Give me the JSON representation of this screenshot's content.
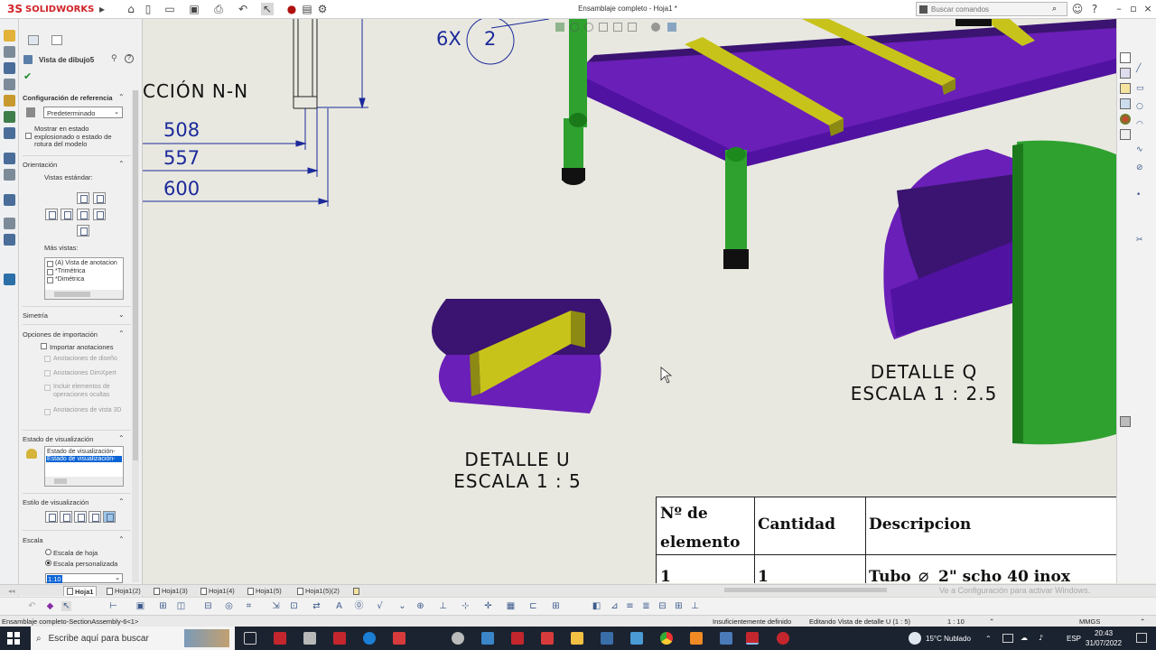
{
  "titlebar": {
    "brand_ds": "3S",
    "brand_name": "SOLIDWORKS",
    "document_title": "Ensamblaje completo - Hoja1 *",
    "search_placeholder": "Buscar comandos"
  },
  "property_manager": {
    "title": "Vista de dibujo5",
    "sections": {
      "reference_config": {
        "header": "Configuración de referencia",
        "selected": "Predeterminado",
        "explode_label": "Mostrar en estado explosionado o estado de rotura del modelo"
      },
      "orientation": {
        "header": "Orientación",
        "standard_views_label": "Vistas estándar:",
        "more_views_label": "Más vistas:",
        "more_views": [
          "(A) Vista de anotacion",
          "*Trimétrica",
          "*Dimétrica"
        ]
      },
      "symmetry": {
        "header": "Simetría"
      },
      "import_options": {
        "header": "Opciones de importación",
        "import_annotations": "Importar anotaciones",
        "design_annotations": "Anotaciones de diseño",
        "dimxpert_annotations": "Anotaciones DimXpert",
        "hidden_ops": "Incluir elementos de operaciones ocultas",
        "view3d_annotations": "Anotaciones de vista 3D"
      },
      "display_state": {
        "header": "Estado de visualización",
        "items": [
          "Estado de visualización-",
          "Estado de visualización-"
        ]
      },
      "display_style": {
        "header": "Estilo de visualización"
      },
      "scale": {
        "header": "Escala",
        "sheet_scale": "Escala de hoja",
        "custom_scale": "Escala personalizada",
        "custom_value": "1:10"
      }
    }
  },
  "drawing": {
    "section_title": "CCIÓN N-N",
    "balloon_qty": "6X",
    "balloon_number": "2",
    "dimensions": [
      "508",
      "557",
      "600"
    ],
    "detail_u": {
      "line1": "DETALLE U",
      "line2": "ESCALA 1 : 5"
    },
    "detail_q": {
      "line1": "DETALLE Q",
      "line2": "ESCALA 1 : 2.5"
    },
    "bom": {
      "headers": [
        "Nº de elemento",
        "Cantidad",
        "Descripcion"
      ],
      "header_item_line1": "Nº de",
      "header_item_line2": "elemento",
      "row1": {
        "item": "1",
        "qty": "1",
        "desc": "Tubo",
        "desc_rest": "2\" scho 40 inox"
      }
    },
    "colors": {
      "purple": "#6a1fb8",
      "dark_purple": "#3a1470",
      "green": "#2fa12f",
      "yellow": "#c8c31a",
      "dim_blue": "#1c2a9a"
    }
  },
  "sheet_tabs": [
    "Hoja1",
    "Hoja1(2)",
    "Hoja1(3)",
    "Hoja1(4)",
    "Hoja1(5)",
    "Hoja1(5)(2)"
  ],
  "watermark": "Ve a Configuración para activar Windows.",
  "statusbar": {
    "left": "Ensamblaje completo-SectionAssembly-6<1>",
    "definition": "Insuficientemente definido",
    "editing": "Editando Vista de detalle U (1 : 5)",
    "scale": "1 : 10",
    "units": "MMGS"
  },
  "taskbar": {
    "search_placeholder": "Escribe aquí para buscar",
    "weather": "15°C  Nublado",
    "language": "ESP",
    "time": "20:43",
    "date": "31/07/2022"
  }
}
